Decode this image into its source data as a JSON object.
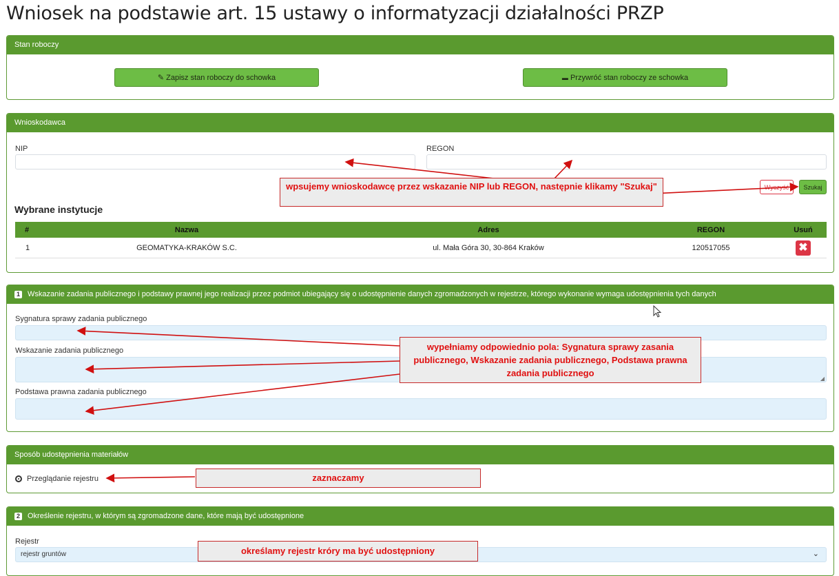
{
  "page": {
    "title": "Wniosek na podstawie art. 15 ustawy o informatyzacji działalności PRZP"
  },
  "draft": {
    "header": "Stan roboczy",
    "save_button": "Zapisz stan roboczy do schowka",
    "restore_button": "Przywróć stan roboczy ze schowka"
  },
  "applicant": {
    "header": "Wnioskodawca",
    "nip_label": "NIP",
    "nip_value": "",
    "regon_label": "REGON",
    "regon_value": "",
    "clear_button": "Wyczyść",
    "search_button": "Szukaj",
    "selected_title": "Wybrane instytucje",
    "table": {
      "headers": [
        "#",
        "Nazwa",
        "Adres",
        "REGON",
        "Usuń"
      ],
      "rows": [
        {
          "num": "1",
          "name": "GEOMATYKA-KRAKÓW S.C.",
          "address": "ul. Mała Góra 30, 30-864 Kraków",
          "regon": "120517055",
          "delete_icon": "✖"
        }
      ]
    }
  },
  "task": {
    "number": "1",
    "header": "Wskazanie zadania publicznego i podstawy prawnej jego realizacji przez podmiot ubiegający się o udostępnienie danych zgromadzonych w rejestrze, którego wykonanie wymaga udostępnienia tych danych",
    "case_signature_label": "Sygnatura sprawy zadania publicznego",
    "task_indication_label": "Wskazanie zadania publicznego",
    "legal_basis_label": "Podstawa prawna zadania publicznego"
  },
  "sharing": {
    "header": "Sposób udostępnienia materiałów",
    "option_label": "Przeglądanie rejestru",
    "option_selected": true
  },
  "register": {
    "number": "2",
    "header": "Określenie rejestru, w którym są zgromadzone dane, które mają być udostępnione",
    "label": "Rejestr",
    "selected": "rejestr gruntów"
  },
  "annotations": {
    "applicant_note": "wpsujemy wnioskodawcę przez wskazanie NIP lub REGON, następnie klikamy \"Szukaj\"",
    "fields_note": "wypełniamy odpowiednio pola: Sygnatura sprawy zasania publicznego, Wskazanie zadania publicznego, Podstawa prawna zadania publicznego",
    "radio_note": "zaznaczamy",
    "register_note": "określamy rejestr króry ma być udostępniony"
  },
  "colors": {
    "header_green": "#5a9a2f",
    "button_green": "#6dbd45",
    "annotation_red": "#e01010",
    "danger": "#dc3545"
  },
  "icons": {
    "save": "pencil-icon",
    "restore": "inbox-icon",
    "delete": "close-icon",
    "select": "chevron-down-icon",
    "cursor": "mouse-cursor-icon"
  }
}
